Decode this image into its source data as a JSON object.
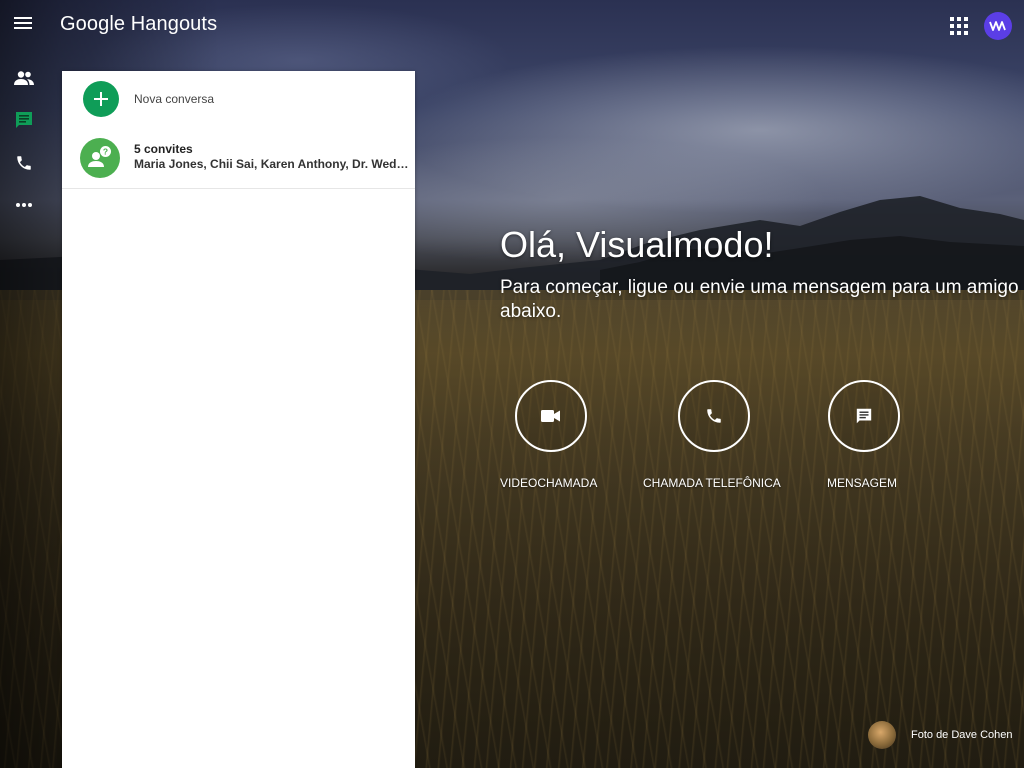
{
  "app": {
    "title": "Google Hangouts",
    "accent": "#0f9d58",
    "avatar_color": "#5b3ee6"
  },
  "header": {
    "menu_icon": "hamburger-menu-icon",
    "apps_icon": "apps-grid-icon",
    "avatar_icon": "account-avatar-icon"
  },
  "rail": {
    "items": [
      {
        "icon": "contacts-icon",
        "active": false
      },
      {
        "icon": "chat-icon",
        "active": true,
        "color": "#0f9d58"
      },
      {
        "icon": "phone-icon",
        "active": false
      },
      {
        "icon": "more-icon",
        "active": false
      }
    ]
  },
  "panel": {
    "new_conversation_label": "Nova conversa",
    "invites": {
      "title": "5 convites",
      "names": "Maria Jones, Chii Sai, Karen Anthony, Dr. Wednesday"
    }
  },
  "welcome": {
    "greeting": "Olá, Visualmodo!",
    "subtitle": "Para começar, ligue ou envie uma mensagem para um amigo abaixo."
  },
  "actions": [
    {
      "label": "VIDEOCHAMADA",
      "icon": "video-camera-icon"
    },
    {
      "label": "CHAMADA TELEFÔNICA",
      "icon": "phone-icon"
    },
    {
      "label": "MENSAGEM",
      "icon": "message-icon"
    }
  ],
  "photo_credit": {
    "text": "Foto de Dave Cohen"
  }
}
